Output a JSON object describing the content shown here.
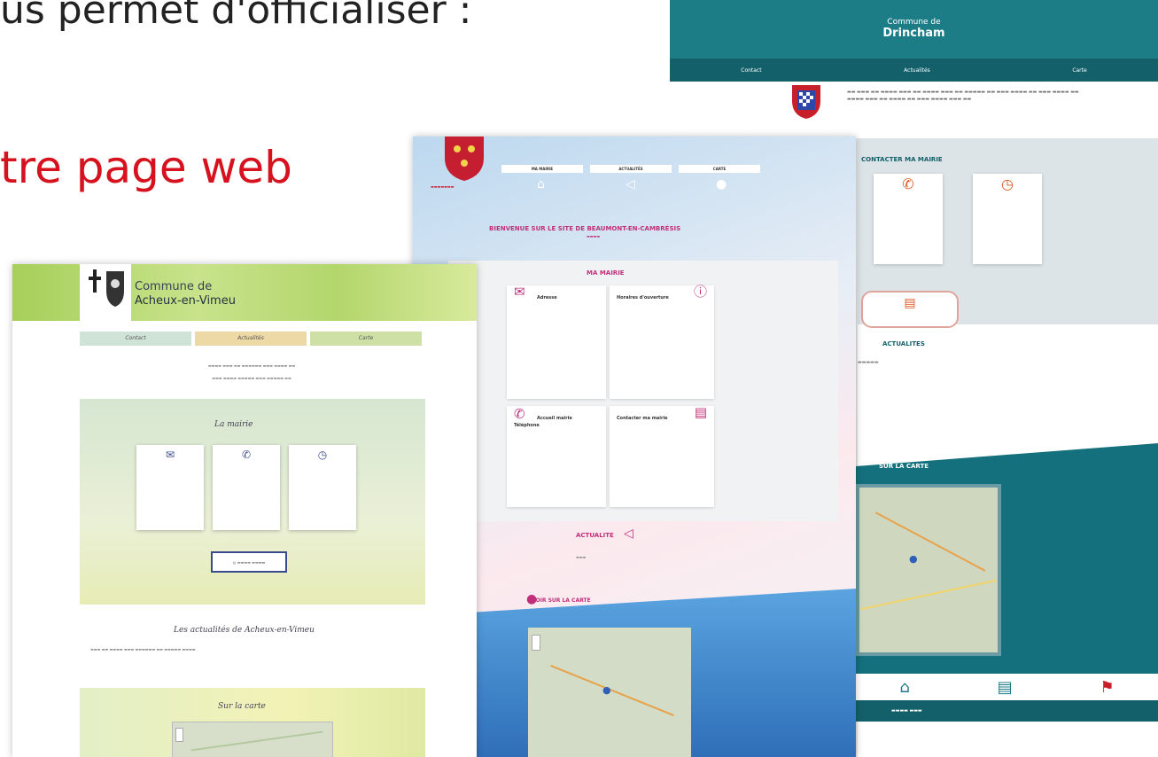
{
  "slide": {
    "headline": "us permet d'officialiser :",
    "subhead": "tre page web"
  },
  "drincham": {
    "pre_title": "Commune de",
    "name": "Drincham",
    "nav": [
      "Contact",
      "Actualités",
      "Carte"
    ],
    "contact_title": "CONTACTER MA MAIRIE",
    "actualites_title": "ACTUALITES",
    "map_title": "SUR LA CARTE"
  },
  "beaumont": {
    "nav": [
      "MA MAIRIE",
      "ACTUALITÉS",
      "CARTE"
    ],
    "welcome": "BIENVENUE SUR LE SITE DE BEAUMONT-EN-CAMBRÉSIS",
    "box_title": "MA MAIRIE",
    "cards": {
      "adresse": "Adresse",
      "horaires": "Horaires d'ouverture",
      "accueil": "Accueil mairie",
      "telephone": "Téléphone",
      "contacter": "Contacter ma mairie"
    },
    "actualite": "ACTUALITE",
    "map_title": "VOIR SUR LA CARTE"
  },
  "acheux": {
    "pre_title": "Commune de",
    "name": "Acheux-en-Vimeu",
    "tabs": [
      "Contact",
      "Actualités",
      "Carte"
    ],
    "mairie_title": "La mairie",
    "actu_title": "Les actualités de Acheux-en-Vimeu",
    "map_title": "Sur la carte"
  },
  "colors": {
    "drincham_teal": "#1d7d87",
    "beaumont_pink": "#c0307a",
    "acheux_green": "#a7cf5a",
    "slide_red": "#d6121e"
  }
}
